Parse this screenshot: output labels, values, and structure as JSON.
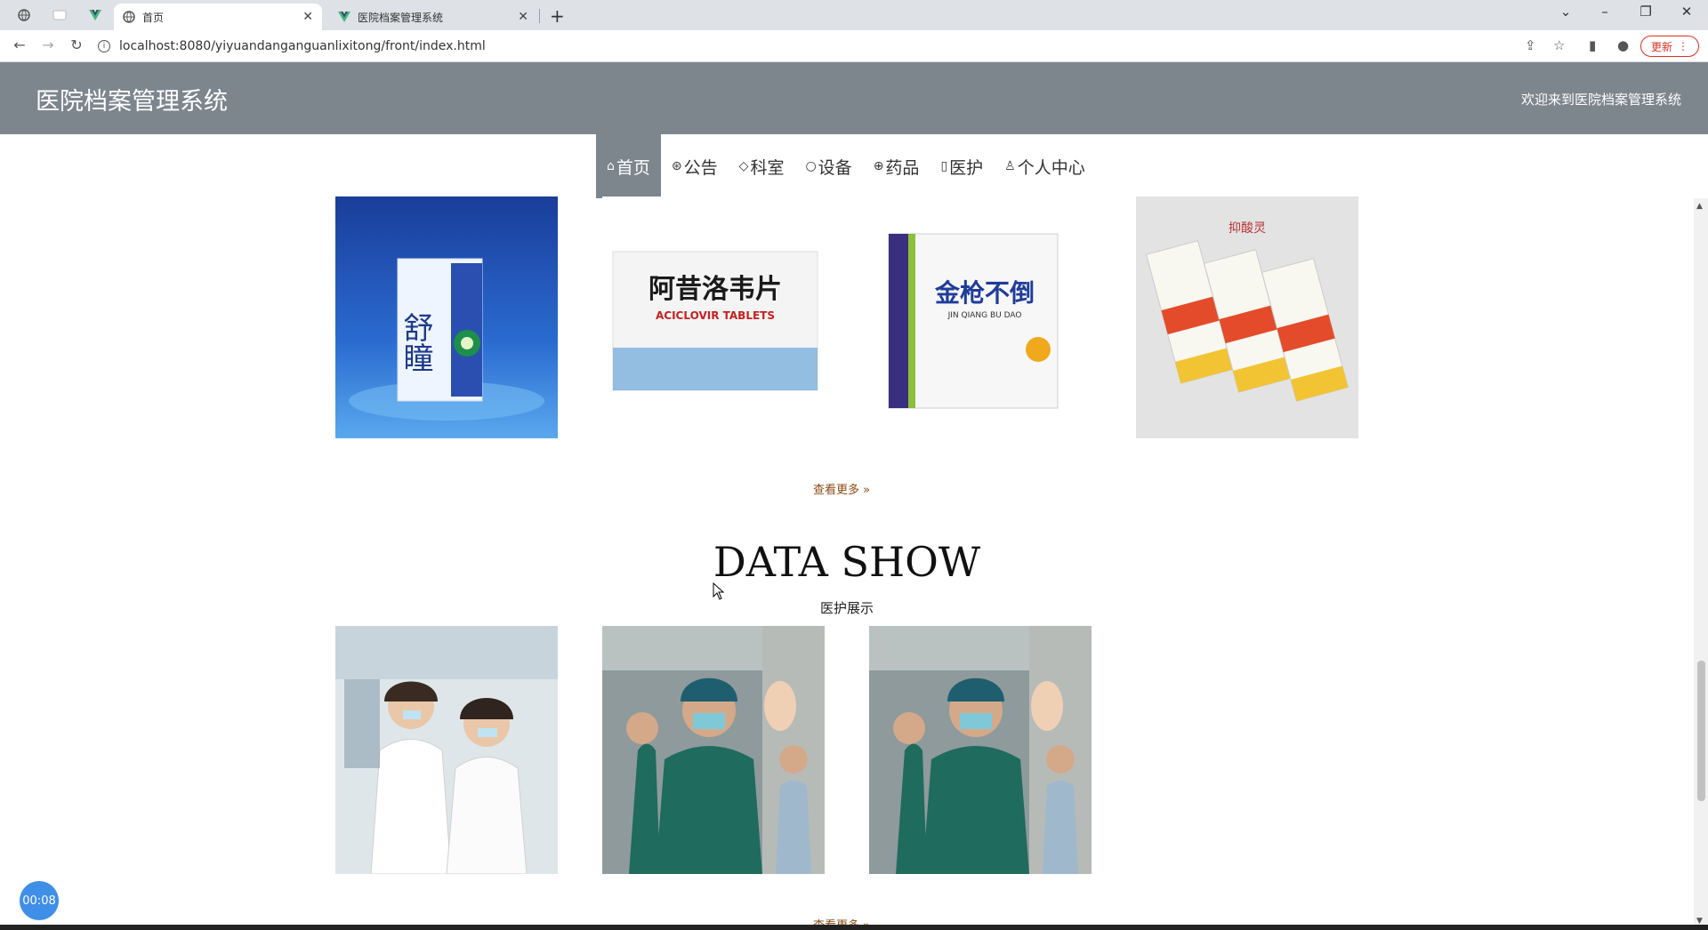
{
  "browser": {
    "tabs": [
      {
        "title": "首页",
        "active": true
      },
      {
        "title": "医院档案管理系统",
        "active": false
      }
    ],
    "url": "localhost:8080/yiyuandanganguanlixitong/front/index.html",
    "update_label": "更新",
    "new_tab": "+",
    "close_glyph": "✕"
  },
  "header": {
    "title": "医院档案管理系统",
    "welcome": "欢迎来到医院档案管理系统"
  },
  "nav": {
    "items": [
      {
        "label": "首页",
        "icon": "home-icon",
        "glyph": "⌂"
      },
      {
        "label": "公告",
        "icon": "megaphone-icon",
        "glyph": "⊛"
      },
      {
        "label": "科室",
        "icon": "tag-icon",
        "glyph": "◇"
      },
      {
        "label": "设备",
        "icon": "circle-icon",
        "glyph": "○"
      },
      {
        "label": "药品",
        "icon": "globe-icon",
        "glyph": "⊕"
      },
      {
        "label": "医护",
        "icon": "document-icon",
        "glyph": "▯"
      },
      {
        "label": "个人中心",
        "icon": "user-icon",
        "glyph": "♙"
      }
    ]
  },
  "medicines": {
    "items": [
      {
        "brand": "舒瞳",
        "name": "舒瞳"
      },
      {
        "brand": "阿昔洛韦片",
        "name": "ACICLOVIR TABLETS"
      },
      {
        "brand": "金枪不倒",
        "name": "JIN QIANG BU DAO"
      },
      {
        "brand": "抑酸灵",
        "name": ""
      }
    ],
    "more_label": "查看更多"
  },
  "staff_section": {
    "title": "DATA SHOW",
    "subtitle": "医护展示",
    "more_label": "查看更多"
  },
  "timer": "00:08",
  "colors": {
    "header_bg": "#7d858d",
    "more_link": "#8b4a12"
  }
}
